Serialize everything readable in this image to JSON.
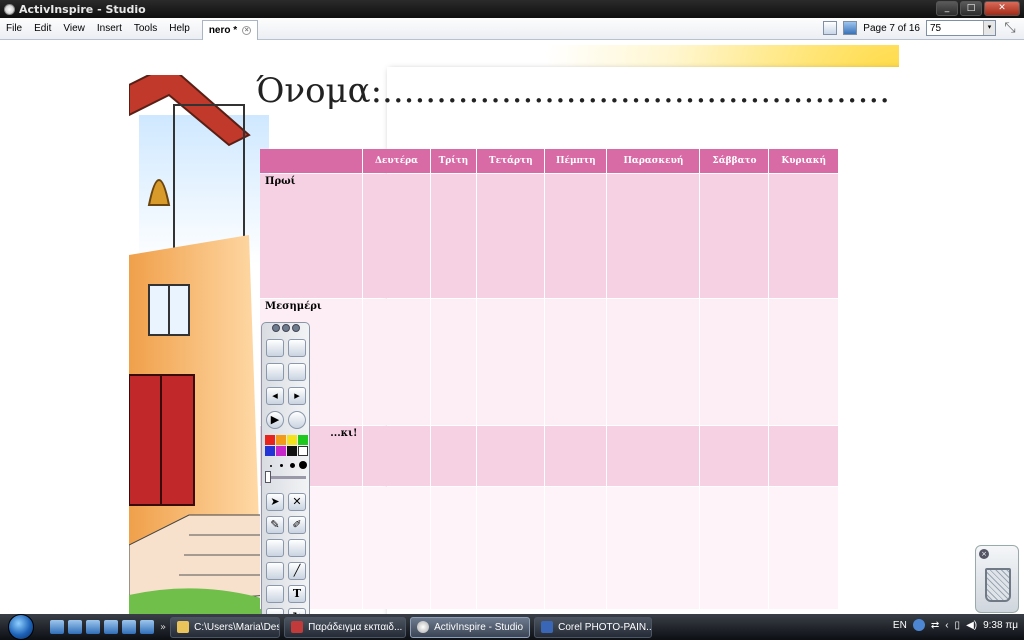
{
  "window": {
    "title": "ActivInspire - Studio",
    "min": "_",
    "max": "□",
    "close": "✕"
  },
  "menu": [
    "File",
    "Edit",
    "View",
    "Insert",
    "Tools",
    "Help"
  ],
  "tab": {
    "label": "nero *",
    "close": "×"
  },
  "pager": {
    "label": "Page 7 of 16",
    "zoom": "75",
    "dropdown": "▾",
    "expand": "⤡"
  },
  "flipchart": {
    "heading": "Όνομα:...............................................",
    "days": [
      "Δευτέρα",
      "Τρίτη",
      "Τετάρτη",
      "Πέμπτη",
      "Παρασκευή",
      "Σάββατο",
      "Κυριακή"
    ],
    "periods": [
      "Πρωί",
      "Μεσημέρι",
      "...κι!",
      ""
    ]
  },
  "toolbox": {
    "colors": [
      "#e8221c",
      "#f29b18",
      "#f5e21a",
      "#1ec81e",
      "#2433d6",
      "#c627c8",
      "#111111",
      "#ffffff"
    ],
    "text_tool": "T"
  },
  "trash": {
    "close": "×"
  },
  "taskbar": {
    "tasks": [
      "C:\\Users\\Maria\\Des...",
      "Παράδειγμα εκπαιδ...",
      "ActivInspire - Studio",
      "Corel PHOTO-PAIN..."
    ],
    "tray": {
      "lang": "EN",
      "time": "9:38 πμ"
    }
  }
}
